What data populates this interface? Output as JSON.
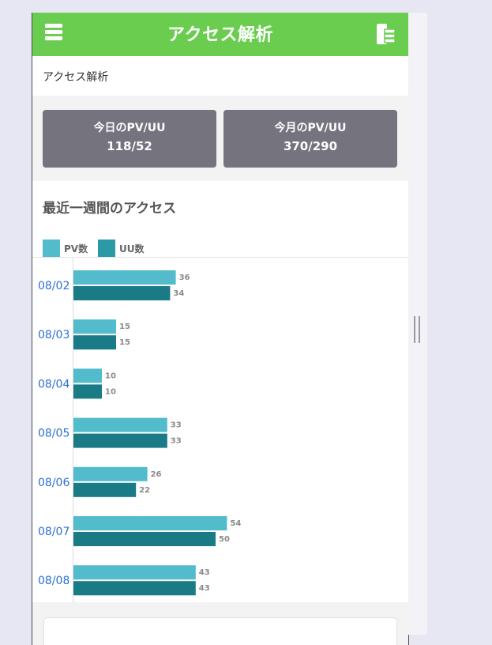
{
  "header": {
    "title": "アクセス解析",
    "menu_icon": "hamburger-menu-icon",
    "book_icon": "book-stack-icon"
  },
  "breadcrumb": {
    "text": "アクセス解析"
  },
  "stats": {
    "today": {
      "label": "今日のPV/UU",
      "value": "118/52"
    },
    "month": {
      "label": "今月のPV/UU",
      "value": "370/290"
    }
  },
  "colors": {
    "header": "#6acd4f",
    "pv": "#52bccd",
    "uu": "#1a7b87",
    "card": "#74737e",
    "date_label": "#2d6fd1"
  },
  "chart_data": {
    "type": "bar",
    "title": "最近一週間のアクセス",
    "orientation": "horizontal",
    "categories": [
      "08/02",
      "08/03",
      "08/04",
      "08/05",
      "08/06",
      "08/07",
      "08/08"
    ],
    "series": [
      {
        "name": "PV数",
        "values": [
          36,
          15,
          10,
          33,
          26,
          54,
          43
        ]
      },
      {
        "name": "UU数",
        "values": [
          34,
          15,
          10,
          33,
          22,
          50,
          43
        ]
      }
    ],
    "xlim": [
      0,
      100
    ],
    "legend": "top-left",
    "grid": false,
    "data_labels": true
  }
}
